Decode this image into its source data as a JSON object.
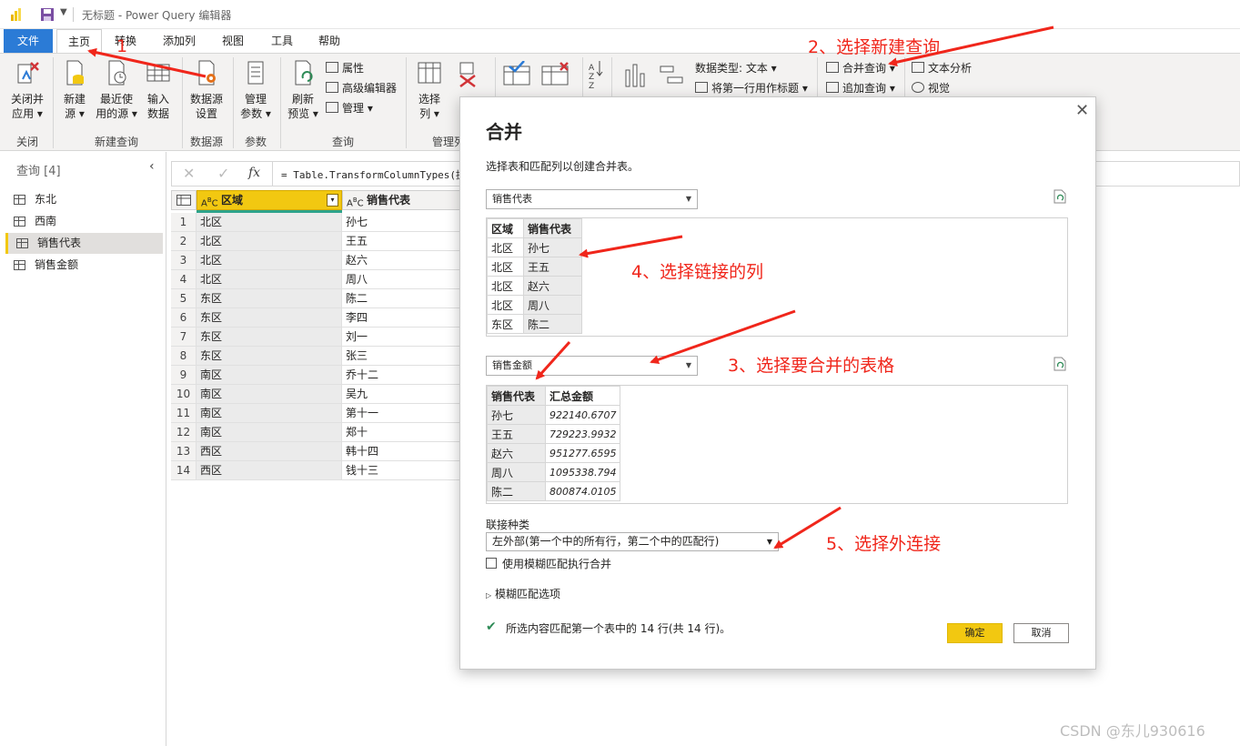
{
  "window": {
    "title": "无标题 - Power Query 编辑器"
  },
  "tabs": [
    "文件",
    "主页",
    "转换",
    "添加列",
    "视图",
    "工具",
    "帮助"
  ],
  "ribbon": {
    "close_apply": [
      "关闭并",
      "应用"
    ],
    "new_source": [
      "新建",
      "源"
    ],
    "recent_sources": [
      "最近使",
      "用的源"
    ],
    "enter_data": [
      "输入",
      "数据"
    ],
    "ds_settings": [
      "数据源",
      "设置"
    ],
    "manage_params": [
      "管理",
      "参数"
    ],
    "refresh_preview": [
      "刷新",
      "预览"
    ],
    "properties": "属性",
    "advanced_editor": "高级编辑器",
    "manage": "管理",
    "choose_columns": [
      "选择",
      "列"
    ],
    "data_type": "数据类型: 文本",
    "first_row_header": "将第一行用作标题",
    "merge_queries": "合并查询",
    "append_queries": "追加查询",
    "text_analytics": "文本分析",
    "vision": "视觉",
    "groups": {
      "close": "关闭",
      "new_query": "新建查询",
      "data_source": "数据源",
      "params": "参数",
      "query": "查询",
      "manage_cols": "管理列"
    }
  },
  "queries": {
    "header": "查询 [4]",
    "items": [
      "东北",
      "西南",
      "销售代表",
      "销售金额"
    ],
    "selected": "销售代表"
  },
  "formula": "= Table.TransformColumnTypes(提",
  "grid": {
    "columns": [
      "区域",
      "销售代表"
    ],
    "rows": [
      [
        "1",
        "北区",
        "孙七"
      ],
      [
        "2",
        "北区",
        "王五"
      ],
      [
        "3",
        "北区",
        "赵六"
      ],
      [
        "4",
        "北区",
        "周八"
      ],
      [
        "5",
        "东区",
        "陈二"
      ],
      [
        "6",
        "东区",
        "李四"
      ],
      [
        "7",
        "东区",
        "刘一"
      ],
      [
        "8",
        "东区",
        "张三"
      ],
      [
        "9",
        "南区",
        "乔十二"
      ],
      [
        "10",
        "南区",
        "吴九"
      ],
      [
        "11",
        "南区",
        "第十一"
      ],
      [
        "12",
        "南区",
        "郑十"
      ],
      [
        "13",
        "西区",
        "韩十四"
      ],
      [
        "14",
        "西区",
        "钱十三"
      ]
    ]
  },
  "dialog": {
    "title": "合并",
    "description": "选择表和匹配列以创建合并表。",
    "table1": "销售代表",
    "table1_columns": [
      "区域",
      "销售代表"
    ],
    "table1_rows": [
      [
        "北区",
        "孙七"
      ],
      [
        "北区",
        "王五"
      ],
      [
        "北区",
        "赵六"
      ],
      [
        "北区",
        "周八"
      ],
      [
        "东区",
        "陈二"
      ]
    ],
    "table2": "销售金额",
    "table2_columns": [
      "销售代表",
      "汇总金额"
    ],
    "table2_rows": [
      [
        "孙七",
        "922140.6707"
      ],
      [
        "王五",
        "729223.9932"
      ],
      [
        "赵六",
        "951277.6595"
      ],
      [
        "周八",
        "1095338.794"
      ],
      [
        "陈二",
        "800874.0105"
      ]
    ],
    "join_kind_label": "联接种类",
    "join_kind": "左外部(第一个中的所有行，第二个中的匹配行)",
    "fuzzy_match": "使用模糊匹配执行合并",
    "fuzzy_options": "模糊匹配选项",
    "status": "所选内容匹配第一个表中的 14 行(共 14 行)。",
    "ok": "确定",
    "cancel": "取消"
  },
  "annotations": {
    "step1": "1",
    "step2": "2、选择新建查询",
    "step3": "3、选择要合并的表格",
    "step4": "4、选择链接的列",
    "step5": "5、选择外连接"
  },
  "watermark": "CSDN @东儿930616",
  "colors": {
    "accent_yellow": "#f2c811",
    "file_tab": "#2b7bd6",
    "annotation_red": "#f0261b"
  }
}
